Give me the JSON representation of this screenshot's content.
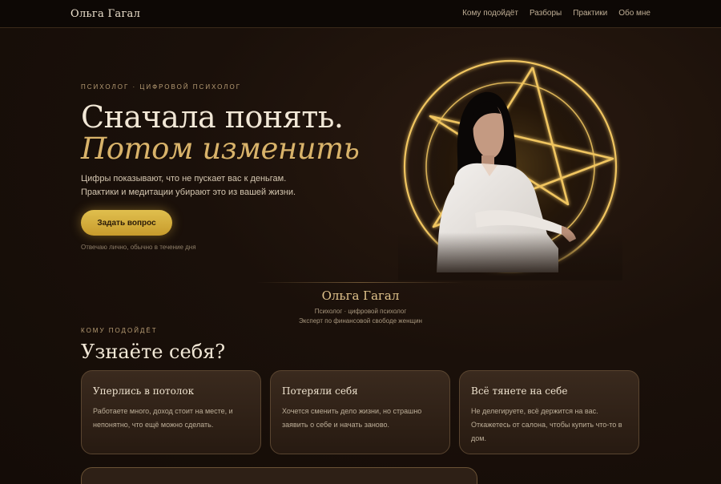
{
  "header": {
    "brand": "Ольга Гагал",
    "nav": [
      "Кому подойдёт",
      "Разборы",
      "Практики",
      "Обо мне"
    ]
  },
  "hero": {
    "eyebrow": "ПСИХОЛОГ · ЦИФРОВОЙ ПСИХОЛОГ",
    "title_line1": "Сначала понять.",
    "title_line2": "Потом изменить",
    "lead_line1": "Цифры показывают, что не пускает вас к деньгам.",
    "lead_line2": "Практики и медитации убирают это из вашей жизни.",
    "cta_label": "Задать вопрос",
    "cta_note": "Отвечаю лично, обычно в течение дня"
  },
  "signature": {
    "name": "Ольга Гагал",
    "role_line1": "Психолог · цифровой психолог",
    "role_line2": "Эксперт по финансовой свободе женщин"
  },
  "audience": {
    "eyebrow": "КОМУ ПОДОЙДЁТ",
    "title": "Узнаёте себя?",
    "cards": [
      {
        "title": "Уперлись в потолок",
        "text": "Работаете много, доход стоит на месте, и непонятно, что ещё можно сделать."
      },
      {
        "title": "Потеряли себя",
        "text": "Хочется сменить дело жизни, но страшно заявить о себе и начать заново."
      },
      {
        "title": "Всё тянете на себе",
        "text": "Не делегируете, всё держится на вас. Откажетесь от салона, чтобы купить что-то в дом."
      }
    ]
  },
  "colors": {
    "accent_gold": "#d9b36a",
    "button_gold": "#d4aa3c",
    "background": "#1a100a"
  }
}
